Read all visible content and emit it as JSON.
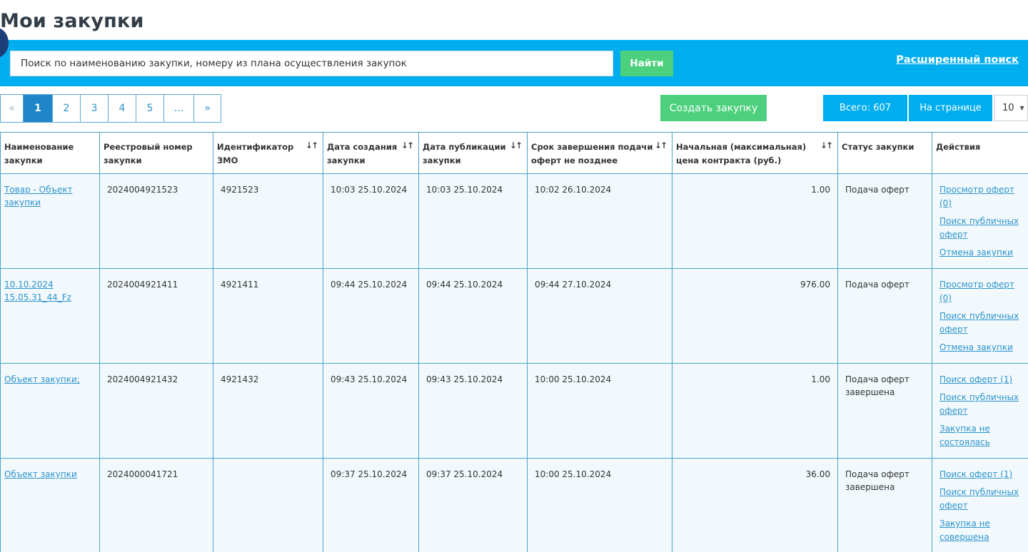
{
  "page": {
    "title": "Мои закупки"
  },
  "search": {
    "placeholder": "Поиск по наименованию закупки, номеру из плана осуществления закупок",
    "button": "Найти",
    "advanced": "Расширенный поиск"
  },
  "pagination": {
    "prev": "«",
    "pages": [
      "1",
      "2",
      "3",
      "4",
      "5"
    ],
    "ellipsis": "...",
    "next": "»",
    "active": "1"
  },
  "toolbar": {
    "create_button": "Создать закупку",
    "total": "Всего: 607",
    "per_page_label": "На странице",
    "per_page_value": "10"
  },
  "table": {
    "columns": [
      "Наименование закупки",
      "Реестровый номер закупки",
      "Идентификатор ЗМО",
      "Дата создания закупки",
      "Дата публикации закупки",
      "Срок завершения подачи оферт не позднее",
      "Начальная (максимальная) цена контракта (руб.)",
      "Статус закупки",
      "Действия"
    ],
    "rows": [
      {
        "name": "Товар - Объект закупки",
        "reg_number": "2024004921523",
        "zmo_id": "4921523",
        "created": "10:03 25.10.2024",
        "published": "10:03 25.10.2024",
        "deadline": "10:02 26.10.2024",
        "price": "1.00",
        "status": "Подача оферт",
        "actions": [
          "Просмотр оферт (0)",
          "Поиск публичных оферт",
          "Отмена закупки"
        ]
      },
      {
        "name": "10.10.2024 15.05.31_44_Fz",
        "reg_number": "2024004921411",
        "zmo_id": "4921411",
        "created": "09:44 25.10.2024",
        "published": "09:44 25.10.2024",
        "deadline": "09:44 27.10.2024",
        "price": "976.00",
        "status": "Подача оферт",
        "actions": [
          "Просмотр оферт (0)",
          "Поиск публичных оферт",
          "Отмена закупки"
        ]
      },
      {
        "name": "Объект закупки;",
        "reg_number": "2024004921432",
        "zmo_id": "4921432",
        "created": "09:43 25.10.2024",
        "published": "09:43 25.10.2024",
        "deadline": "10:00 25.10.2024",
        "price": "1.00",
        "status": "Подача оферт завершена",
        "actions": [
          "Поиск оферт (1)",
          "Поиск публичных оферт",
          "Закупка не состоялась"
        ]
      },
      {
        "name": "Объект закупки",
        "reg_number": "2024000041721",
        "zmo_id": "",
        "created": "09:37 25.10.2024",
        "published": "09:37 25.10.2024",
        "deadline": "10:00 25.10.2024",
        "price": "36.00",
        "status": "Подача оферт завершена",
        "actions": [
          "Поиск оферт (1)",
          "Поиск публичных оферт",
          "Закупка не совершена"
        ]
      }
    ]
  },
  "colors": {
    "accent_blue": "#00aeef",
    "green": "#4cd07d",
    "link": "#2c93cc",
    "border": "#4aa3c9"
  }
}
